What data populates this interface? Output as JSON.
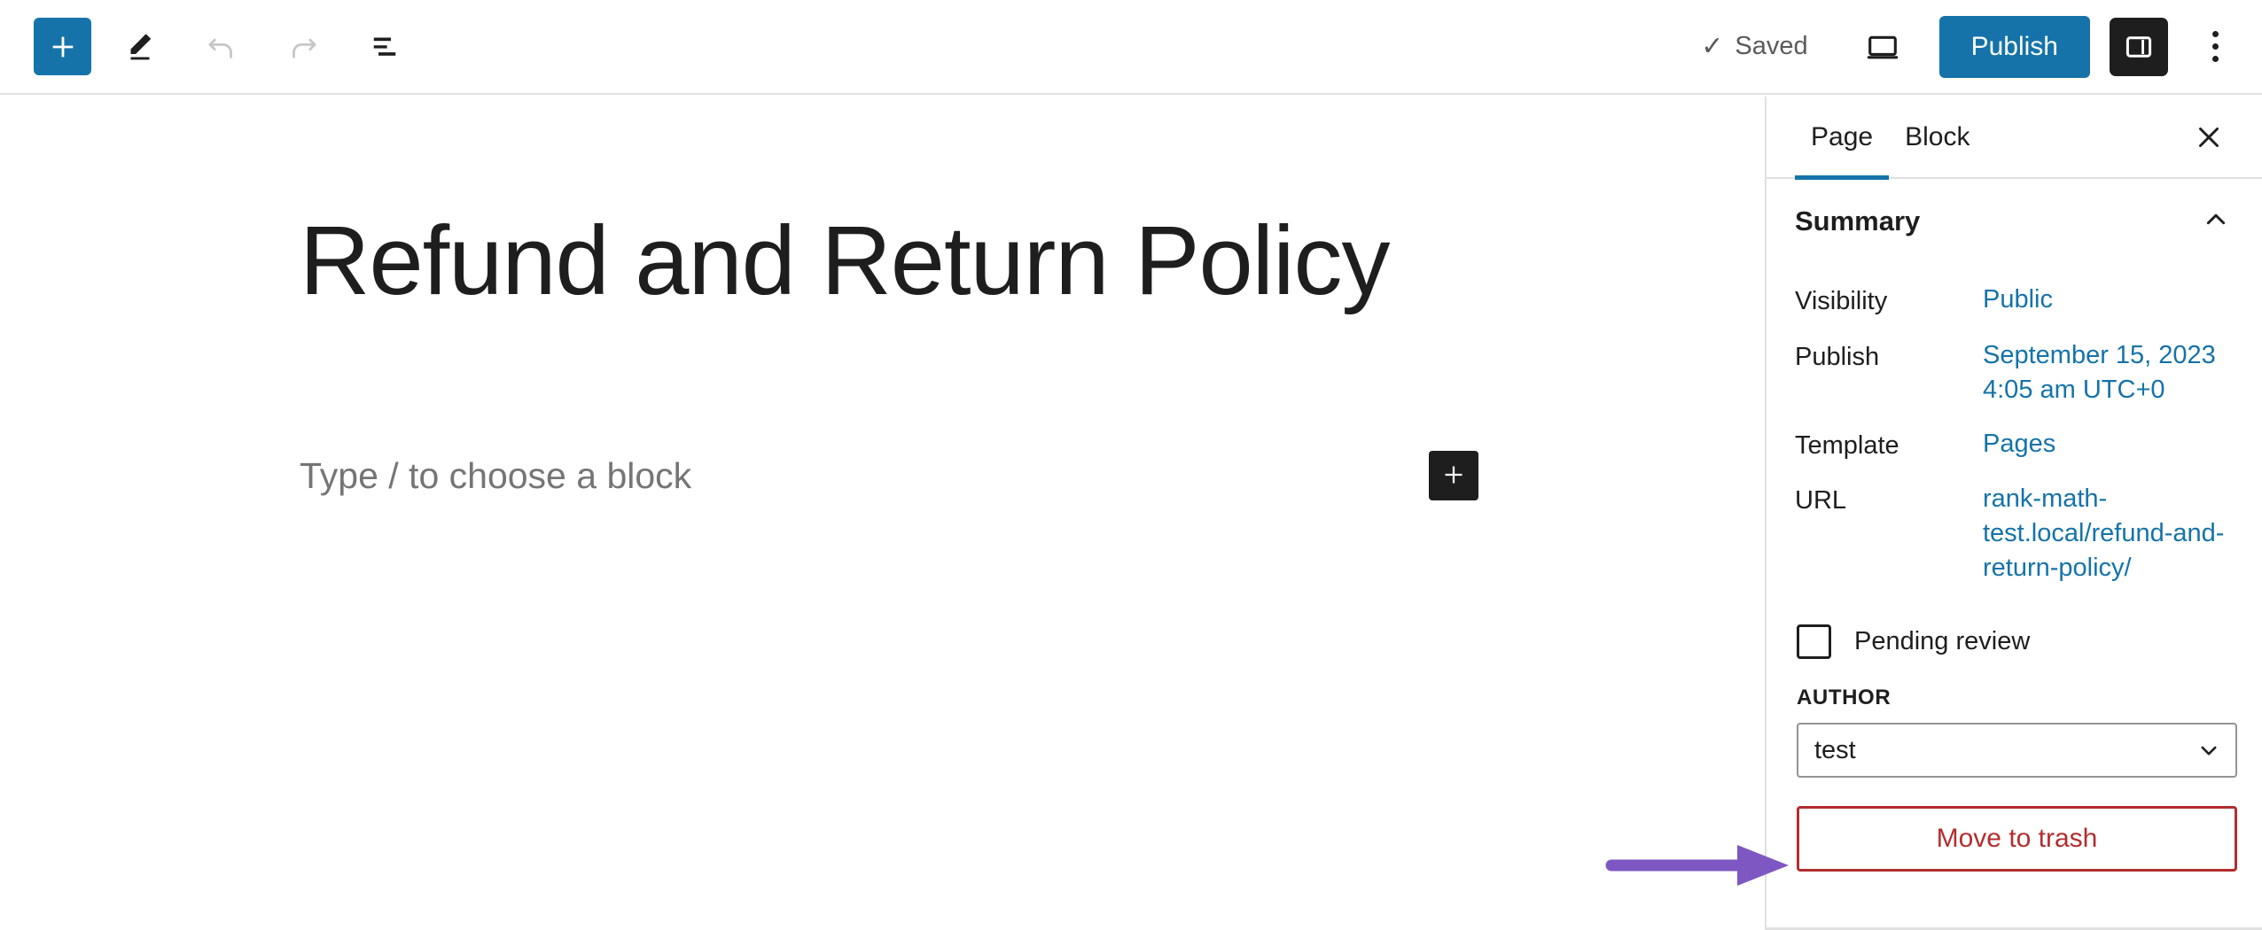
{
  "header": {
    "add_block_label": "Add block",
    "tools_label": "Tools",
    "undo_label": "Undo",
    "redo_label": "Redo",
    "list_view_label": "Document Overview",
    "save_status": "Saved",
    "save_check": "✓",
    "preview_label": "Preview",
    "publish_label": "Publish",
    "settings_label": "Settings",
    "options_label": "Options",
    "accent_color": "#1573a9",
    "dark_color": "#1e1e1e"
  },
  "editor": {
    "title": "Refund and Return Policy",
    "block_placeholder": "Type / to choose a block",
    "inserter_label": "Add block"
  },
  "sidebar": {
    "tabs": [
      {
        "label": "Page",
        "active": true
      },
      {
        "label": "Block",
        "active": false
      }
    ],
    "close_label": "Close Settings",
    "summary": {
      "title": "Summary",
      "collapse_label": "Collapse Summary",
      "rows": [
        {
          "label": "Visibility",
          "value": "Public"
        },
        {
          "label": "Publish",
          "value": "September 15, 2023 4:05 am UTC+0"
        },
        {
          "label": "Template",
          "value": "Pages"
        },
        {
          "label": "URL",
          "value": "rank-math-test.local/refund-and-return-policy/"
        }
      ]
    },
    "pending_review": {
      "label": "Pending review",
      "checked": false
    },
    "author": {
      "label": "AUTHOR",
      "value": "test"
    },
    "trash": {
      "label": "Move to trash",
      "color": "#b32d2e"
    }
  },
  "annotation": {
    "arrow_color": "#7e57c2",
    "points_to": "Move to trash"
  }
}
